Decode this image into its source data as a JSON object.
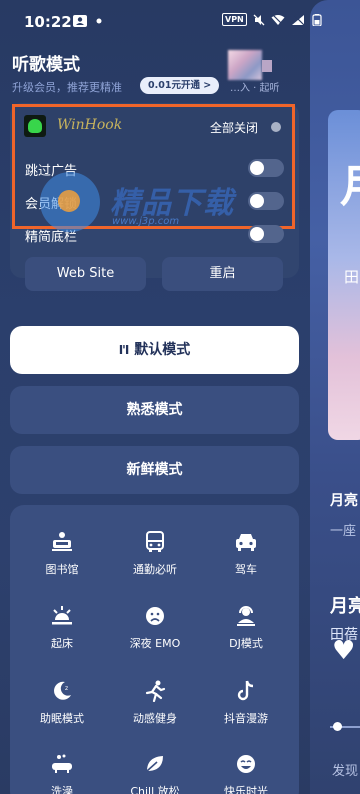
{
  "status_bar": {
    "time": "10:22",
    "vpn": "VPN"
  },
  "header": {
    "title": "听歌模式",
    "upgrade_text": "升级会员，推荐更精准",
    "upgrade_pill": "0.01元开通 >",
    "right_text": "…入 · 起听"
  },
  "winhook": {
    "name": "WinHook",
    "all_close": "全部关闭",
    "options": [
      {
        "label": "跳过广告",
        "on": false
      },
      {
        "label": "会员解锁",
        "on": false
      },
      {
        "label": "精简底栏",
        "on": false
      }
    ],
    "watermark_text": "精品下载",
    "watermark_url": "www.j3p.com"
  },
  "sub_buttons": {
    "website": "Web Site",
    "restart": "重启"
  },
  "modes": {
    "default": "默认模式",
    "familiar": "熟悉模式",
    "fresh": "新鲜模式"
  },
  "scenes": [
    {
      "label": "图书馆",
      "icon": "library-icon"
    },
    {
      "label": "通勤必听",
      "icon": "bus-icon"
    },
    {
      "label": "驾车",
      "icon": "car-icon"
    },
    {
      "label": "起床",
      "icon": "sunrise-icon"
    },
    {
      "label": "深夜 EMO",
      "icon": "sad-face-icon"
    },
    {
      "label": "DJ模式",
      "icon": "dj-icon"
    },
    {
      "label": "助眠模式",
      "icon": "moon-icon"
    },
    {
      "label": "动感健身",
      "icon": "running-icon"
    },
    {
      "label": "抖音漫游",
      "icon": "tiktok-icon"
    },
    {
      "label": "洗澡",
      "icon": "bath-icon"
    },
    {
      "label": "Chill 放松",
      "icon": "leaf-icon"
    },
    {
      "label": "快乐时光",
      "icon": "happy-icon"
    }
  ],
  "peek": {
    "big_glyph": "月",
    "small_glyph": "田",
    "title1": "月亮",
    "sub1": "一座",
    "title2": "月亮",
    "sub2": "田蓓",
    "find": "发现"
  }
}
